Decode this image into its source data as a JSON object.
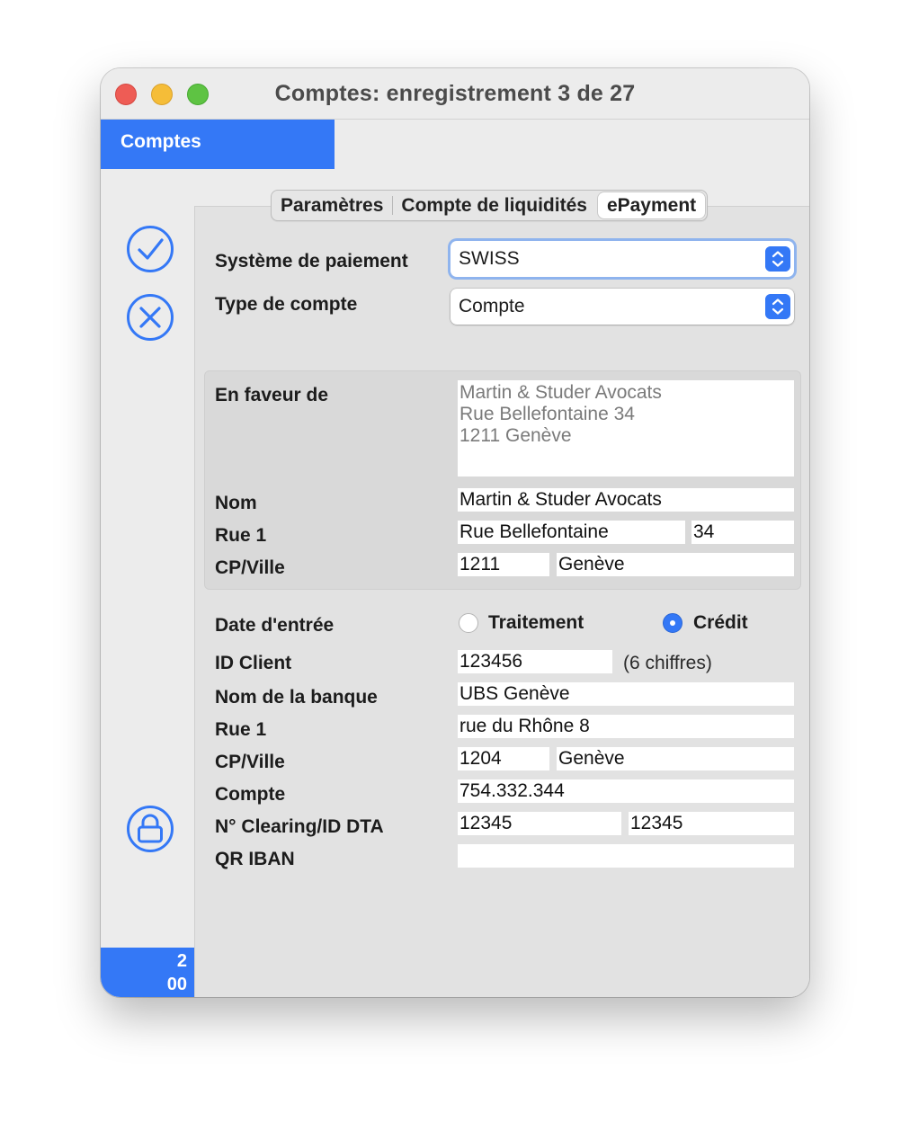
{
  "window": {
    "title": "Comptes: enregistrement 3 de 27",
    "module_tab": "Comptes",
    "badge_line1": "2",
    "badge_line2": "00"
  },
  "toolbar": {
    "confirm_icon": "checkmark-circle-icon",
    "cancel_icon": "x-circle-icon",
    "lock_icon": "lock-circle-icon"
  },
  "tabs": [
    {
      "label": "Paramètres",
      "active": false
    },
    {
      "label": "Compte de liquidités",
      "active": false
    },
    {
      "label": "ePayment",
      "active": true
    }
  ],
  "payment": {
    "system_label": "Système de paiement",
    "system_value": "SWISS",
    "account_type_label": "Type de compte",
    "account_type_value": "Compte"
  },
  "beneficiary": {
    "in_favor_label": "En faveur de",
    "address_lines": [
      "Martin & Studer Avocats",
      "Rue Bellefontaine 34",
      "1211 Genève"
    ],
    "name_label": "Nom",
    "name_value": "Martin & Studer Avocats",
    "street_label": "Rue 1",
    "street_value": "Rue Bellefontaine",
    "street_number": "34",
    "city_label": "CP/Ville",
    "postcode": "1211",
    "city": "Genève"
  },
  "entry": {
    "date_label": "Date d'entrée",
    "option_processing": "Traitement",
    "option_credit": "Crédit",
    "selected": "Crédit"
  },
  "bank": {
    "client_id_label": "ID Client",
    "client_id_value": "123456",
    "client_id_hint": "(6 chiffres)",
    "bank_name_label": "Nom de la banque",
    "bank_name_value": "UBS Genève",
    "street_label": "Rue 1",
    "street_value": "rue du Rhône 8",
    "city_label": "CP/Ville",
    "postcode": "1204",
    "city": "Genève",
    "account_label": "Compte",
    "account_value": "754.332.344",
    "clearing_label": "N° Clearing/ID DTA",
    "clearing_value": "12345",
    "dta_value": "12345",
    "qr_iban_label": "QR IBAN",
    "qr_iban_value": ""
  },
  "colors": {
    "accent": "#3478f6",
    "window_bg": "#ececec",
    "panel_bg": "#e2e2e2"
  }
}
